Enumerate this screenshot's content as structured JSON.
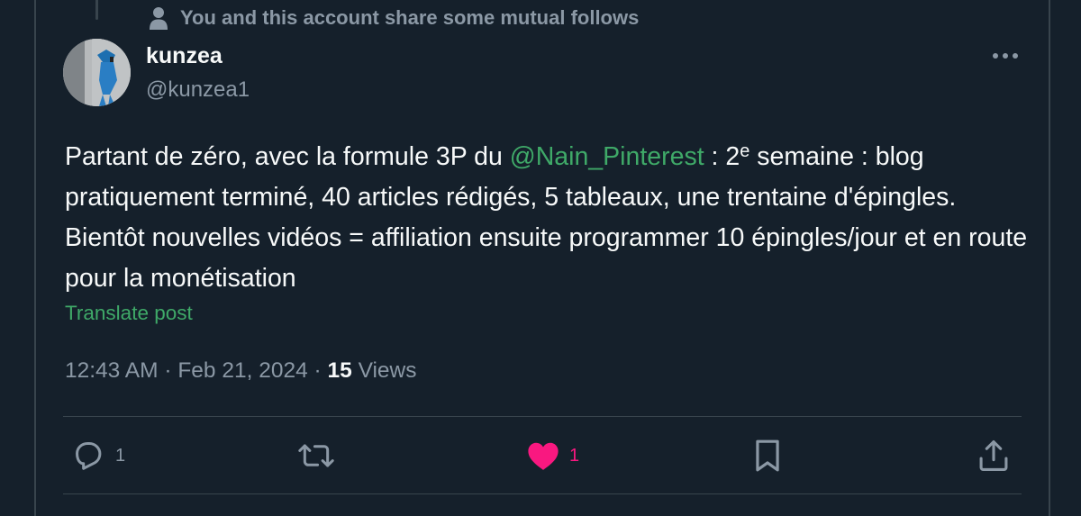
{
  "social_context": {
    "text": "You and this account share some mutual follows",
    "icon": "person-icon"
  },
  "author": {
    "display_name": "kunzea",
    "handle": "@kunzea1",
    "avatar_icon": "avatar"
  },
  "tweet": {
    "text_part1": "Partant de zéro, avec la formule 3P du ",
    "mention": "@Nain_Pinterest",
    "text_part2": "  : 2",
    "superscript": "e",
    "text_part3": " semaine : blog pratiquement terminé, 40 articles rédigés, 5 tableaux, une trentaine d'épingles. Bientôt nouvelles vidéos = affiliation ensuite programmer 10 épingles/jour et en route pour la monétisation"
  },
  "translate_label": "Translate post",
  "meta": {
    "time": "12:43 AM",
    "separator": "·",
    "date": "Feb 21, 2024",
    "views_count": "15",
    "views_label": "Views"
  },
  "actions": {
    "reply_count": "1",
    "retweet_count": "",
    "like_count": "1",
    "bookmark_count": "",
    "share_count": ""
  },
  "colors": {
    "background": "#15202b",
    "text_primary": "#f7f9f9",
    "text_secondary": "#8b98a5",
    "accent_link": "#3fa968",
    "like": "#f91880",
    "border": "#38444d"
  }
}
